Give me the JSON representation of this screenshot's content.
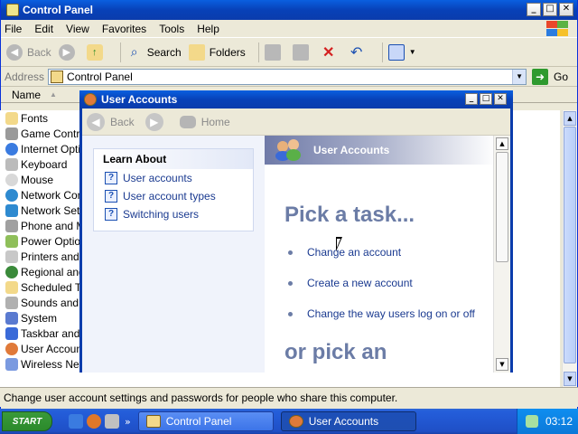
{
  "control_panel": {
    "title": "Control Panel",
    "menu": [
      "File",
      "Edit",
      "View",
      "Favorites",
      "Tools",
      "Help"
    ],
    "toolbar": {
      "back": "Back",
      "search": "Search",
      "folders": "Folders"
    },
    "address": {
      "label": "Address",
      "value": "Control Panel",
      "go": "Go"
    },
    "list_header": "Name",
    "items": [
      "Fonts",
      "Game Controllers",
      "Internet Options",
      "Keyboard",
      "Mouse",
      "Network Connections",
      "Network Setup Wizard",
      "Phone and Modem Options",
      "Power Options",
      "Printers and Faxes",
      "Regional and Language Options",
      "Scheduled Tasks",
      "Sounds and Audio Devices",
      "System",
      "Taskbar and Start Menu",
      "User Accounts",
      "Wireless Network Setup Wizard"
    ],
    "status": "Change user account settings and passwords for people who share this computer."
  },
  "user_accounts": {
    "title": "User Accounts",
    "nav": {
      "back": "Back",
      "home": "Home"
    },
    "learn_about": {
      "heading": "Learn About",
      "links": [
        "User accounts",
        "User account types",
        "Switching users"
      ]
    },
    "band_label": "User Accounts",
    "pick_task": "Pick a task...",
    "tasks": [
      "Change an account",
      "Create a new account",
      "Change the way users log on or off"
    ],
    "pick_icon": "or pick an"
  },
  "taskbar": {
    "start": "START",
    "buttons": [
      "Control Panel",
      "User Accounts"
    ],
    "clock": "03:12"
  },
  "colors": {
    "titlebar": "#0a5fe0",
    "link": "#1a3a90",
    "heading": "#6b7ca6",
    "taskbar": "#245edb"
  }
}
